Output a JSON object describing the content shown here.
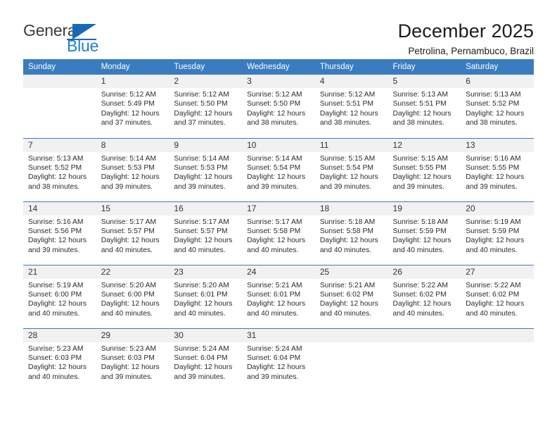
{
  "logo": {
    "word_top": "General",
    "word_bottom": "Blue",
    "triangle_color": "#1669b5",
    "blue_color": "#1f7fd0",
    "gray_color": "#3c3c3c"
  },
  "header": {
    "title": "December 2025",
    "subtitle": "Petrolina, Pernambuco, Brazil"
  },
  "theme": {
    "header_bg": "#3a7cc0",
    "daynum_bg": "#f1f1f1",
    "rule_color": "#3a7cc0",
    "text_color": "#2b2b2b"
  },
  "weekday_headers": [
    "Sunday",
    "Monday",
    "Tuesday",
    "Wednesday",
    "Thursday",
    "Friday",
    "Saturday"
  ],
  "weeks": [
    [
      {
        "day": "",
        "sunrise": "",
        "sunset": "",
        "daylight1": "",
        "daylight2": "",
        "empty": true
      },
      {
        "day": "1",
        "sunrise": "Sunrise: 5:12 AM",
        "sunset": "Sunset: 5:49 PM",
        "daylight1": "Daylight: 12 hours",
        "daylight2": "and 37 minutes."
      },
      {
        "day": "2",
        "sunrise": "Sunrise: 5:12 AM",
        "sunset": "Sunset: 5:50 PM",
        "daylight1": "Daylight: 12 hours",
        "daylight2": "and 37 minutes."
      },
      {
        "day": "3",
        "sunrise": "Sunrise: 5:12 AM",
        "sunset": "Sunset: 5:50 PM",
        "daylight1": "Daylight: 12 hours",
        "daylight2": "and 38 minutes."
      },
      {
        "day": "4",
        "sunrise": "Sunrise: 5:12 AM",
        "sunset": "Sunset: 5:51 PM",
        "daylight1": "Daylight: 12 hours",
        "daylight2": "and 38 minutes."
      },
      {
        "day": "5",
        "sunrise": "Sunrise: 5:13 AM",
        "sunset": "Sunset: 5:51 PM",
        "daylight1": "Daylight: 12 hours",
        "daylight2": "and 38 minutes."
      },
      {
        "day": "6",
        "sunrise": "Sunrise: 5:13 AM",
        "sunset": "Sunset: 5:52 PM",
        "daylight1": "Daylight: 12 hours",
        "daylight2": "and 38 minutes."
      }
    ],
    [
      {
        "day": "7",
        "sunrise": "Sunrise: 5:13 AM",
        "sunset": "Sunset: 5:52 PM",
        "daylight1": "Daylight: 12 hours",
        "daylight2": "and 38 minutes."
      },
      {
        "day": "8",
        "sunrise": "Sunrise: 5:14 AM",
        "sunset": "Sunset: 5:53 PM",
        "daylight1": "Daylight: 12 hours",
        "daylight2": "and 39 minutes."
      },
      {
        "day": "9",
        "sunrise": "Sunrise: 5:14 AM",
        "sunset": "Sunset: 5:53 PM",
        "daylight1": "Daylight: 12 hours",
        "daylight2": "and 39 minutes."
      },
      {
        "day": "10",
        "sunrise": "Sunrise: 5:14 AM",
        "sunset": "Sunset: 5:54 PM",
        "daylight1": "Daylight: 12 hours",
        "daylight2": "and 39 minutes."
      },
      {
        "day": "11",
        "sunrise": "Sunrise: 5:15 AM",
        "sunset": "Sunset: 5:54 PM",
        "daylight1": "Daylight: 12 hours",
        "daylight2": "and 39 minutes."
      },
      {
        "day": "12",
        "sunrise": "Sunrise: 5:15 AM",
        "sunset": "Sunset: 5:55 PM",
        "daylight1": "Daylight: 12 hours",
        "daylight2": "and 39 minutes."
      },
      {
        "day": "13",
        "sunrise": "Sunrise: 5:16 AM",
        "sunset": "Sunset: 5:55 PM",
        "daylight1": "Daylight: 12 hours",
        "daylight2": "and 39 minutes."
      }
    ],
    [
      {
        "day": "14",
        "sunrise": "Sunrise: 5:16 AM",
        "sunset": "Sunset: 5:56 PM",
        "daylight1": "Daylight: 12 hours",
        "daylight2": "and 39 minutes."
      },
      {
        "day": "15",
        "sunrise": "Sunrise: 5:17 AM",
        "sunset": "Sunset: 5:57 PM",
        "daylight1": "Daylight: 12 hours",
        "daylight2": "and 40 minutes."
      },
      {
        "day": "16",
        "sunrise": "Sunrise: 5:17 AM",
        "sunset": "Sunset: 5:57 PM",
        "daylight1": "Daylight: 12 hours",
        "daylight2": "and 40 minutes."
      },
      {
        "day": "17",
        "sunrise": "Sunrise: 5:17 AM",
        "sunset": "Sunset: 5:58 PM",
        "daylight1": "Daylight: 12 hours",
        "daylight2": "and 40 minutes."
      },
      {
        "day": "18",
        "sunrise": "Sunrise: 5:18 AM",
        "sunset": "Sunset: 5:58 PM",
        "daylight1": "Daylight: 12 hours",
        "daylight2": "and 40 minutes."
      },
      {
        "day": "19",
        "sunrise": "Sunrise: 5:18 AM",
        "sunset": "Sunset: 5:59 PM",
        "daylight1": "Daylight: 12 hours",
        "daylight2": "and 40 minutes."
      },
      {
        "day": "20",
        "sunrise": "Sunrise: 5:19 AM",
        "sunset": "Sunset: 5:59 PM",
        "daylight1": "Daylight: 12 hours",
        "daylight2": "and 40 minutes."
      }
    ],
    [
      {
        "day": "21",
        "sunrise": "Sunrise: 5:19 AM",
        "sunset": "Sunset: 6:00 PM",
        "daylight1": "Daylight: 12 hours",
        "daylight2": "and 40 minutes."
      },
      {
        "day": "22",
        "sunrise": "Sunrise: 5:20 AM",
        "sunset": "Sunset: 6:00 PM",
        "daylight1": "Daylight: 12 hours",
        "daylight2": "and 40 minutes."
      },
      {
        "day": "23",
        "sunrise": "Sunrise: 5:20 AM",
        "sunset": "Sunset: 6:01 PM",
        "daylight1": "Daylight: 12 hours",
        "daylight2": "and 40 minutes."
      },
      {
        "day": "24",
        "sunrise": "Sunrise: 5:21 AM",
        "sunset": "Sunset: 6:01 PM",
        "daylight1": "Daylight: 12 hours",
        "daylight2": "and 40 minutes."
      },
      {
        "day": "25",
        "sunrise": "Sunrise: 5:21 AM",
        "sunset": "Sunset: 6:02 PM",
        "daylight1": "Daylight: 12 hours",
        "daylight2": "and 40 minutes."
      },
      {
        "day": "26",
        "sunrise": "Sunrise: 5:22 AM",
        "sunset": "Sunset: 6:02 PM",
        "daylight1": "Daylight: 12 hours",
        "daylight2": "and 40 minutes."
      },
      {
        "day": "27",
        "sunrise": "Sunrise: 5:22 AM",
        "sunset": "Sunset: 6:02 PM",
        "daylight1": "Daylight: 12 hours",
        "daylight2": "and 40 minutes."
      }
    ],
    [
      {
        "day": "28",
        "sunrise": "Sunrise: 5:23 AM",
        "sunset": "Sunset: 6:03 PM",
        "daylight1": "Daylight: 12 hours",
        "daylight2": "and 40 minutes."
      },
      {
        "day": "29",
        "sunrise": "Sunrise: 5:23 AM",
        "sunset": "Sunset: 6:03 PM",
        "daylight1": "Daylight: 12 hours",
        "daylight2": "and 39 minutes."
      },
      {
        "day": "30",
        "sunrise": "Sunrise: 5:24 AM",
        "sunset": "Sunset: 6:04 PM",
        "daylight1": "Daylight: 12 hours",
        "daylight2": "and 39 minutes."
      },
      {
        "day": "31",
        "sunrise": "Sunrise: 5:24 AM",
        "sunset": "Sunset: 6:04 PM",
        "daylight1": "Daylight: 12 hours",
        "daylight2": "and 39 minutes."
      },
      {
        "day": "",
        "sunrise": "",
        "sunset": "",
        "daylight1": "",
        "daylight2": "",
        "empty": true
      },
      {
        "day": "",
        "sunrise": "",
        "sunset": "",
        "daylight1": "",
        "daylight2": "",
        "empty": true
      },
      {
        "day": "",
        "sunrise": "",
        "sunset": "",
        "daylight1": "",
        "daylight2": "",
        "empty": true
      }
    ]
  ]
}
